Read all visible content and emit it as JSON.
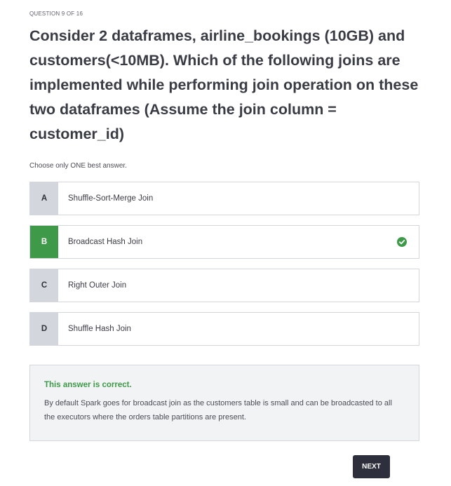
{
  "question": {
    "counter": "QUESTION 9 OF 16",
    "title": "Consider 2 dataframes, airline_bookings (10GB) and customers(<10MB). Which of the following joins are implemented while performing join operation on these two dataframes (Assume the join column = customer_id)",
    "instructions": "Choose only ONE best answer."
  },
  "options": [
    {
      "letter": "A",
      "text": "Shuffle-Sort-Merge Join",
      "correct": false
    },
    {
      "letter": "B",
      "text": "Broadcast Hash Join",
      "correct": true,
      "icon": "check-circle-icon"
    },
    {
      "letter": "C",
      "text": "Right Outer Join",
      "correct": false
    },
    {
      "letter": "D",
      "text": "Shuffle Hash Join",
      "correct": false
    }
  ],
  "feedback": {
    "result": "This answer is correct.",
    "explanation": "By default Spark goes for broadcast join as the customers table is small and can be broadcasted to all the executors where the orders table partitions are present."
  },
  "next_label": "NEXT",
  "colors": {
    "correct": "#3e9a48",
    "option_letter_bg": "#d3d6dd",
    "button_bg": "#2d2f3d",
    "feedback_bg": "#f2f3f5"
  }
}
